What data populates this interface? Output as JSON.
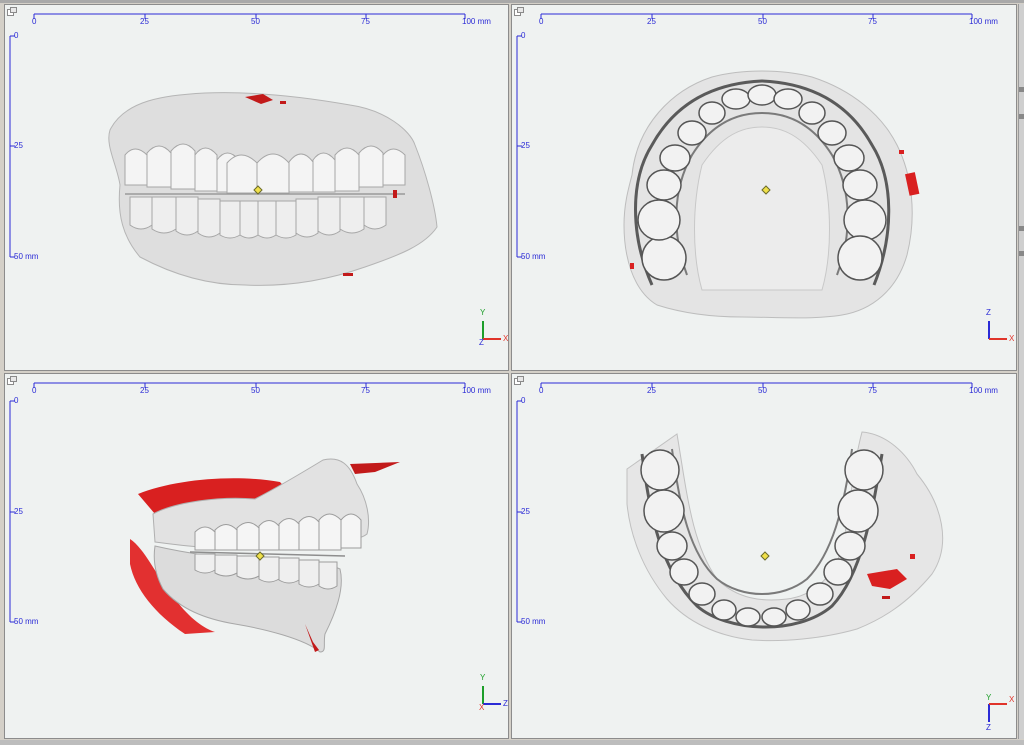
{
  "colors": {
    "ruler": "#2b2bd6",
    "background": "#eff2f1",
    "model": "#dcdcdc",
    "texture_red": "#d92020",
    "axis_x": "#e0342a",
    "axis_y": "#1d9e2a",
    "axis_z": "#2b2bd6",
    "marker": "#f0e04a"
  },
  "ruler": {
    "h_ticks": [
      "0",
      "25",
      "50",
      "75",
      "100 mm"
    ],
    "v_ticks": [
      "0",
      "25",
      "50 mm"
    ]
  },
  "viewports": [
    {
      "id": "front",
      "axis_up": "Y",
      "axis_right": "X",
      "axis_origin": "Z",
      "icon": "dental-model-front-icon"
    },
    {
      "id": "top",
      "axis_up": "Z",
      "axis_right": "X",
      "axis_origin": "",
      "icon": "dental-model-maxilla-icon"
    },
    {
      "id": "side",
      "axis_up": "Y",
      "axis_right": "Z",
      "axis_origin": "X",
      "icon": "dental-model-side-icon"
    },
    {
      "id": "bottom",
      "axis_up": "Z",
      "axis_right": "X",
      "axis_origin": "Y",
      "icon": "dental-model-mandible-icon"
    }
  ]
}
